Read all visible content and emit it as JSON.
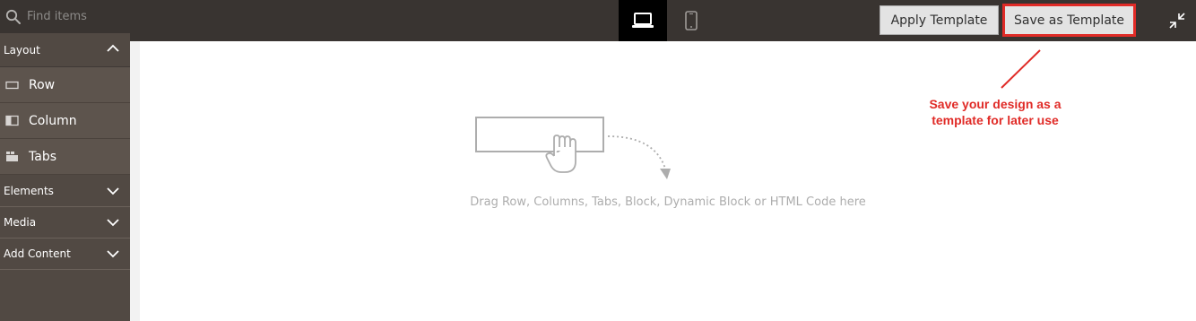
{
  "search": {
    "placeholder": "Find items",
    "value": ""
  },
  "toolbar": {
    "apply_template_label": "Apply Template",
    "save_template_label": "Save as Template",
    "devices": [
      "desktop",
      "mobile"
    ],
    "active_device": "desktop"
  },
  "sidebar": {
    "layout": {
      "label": "Layout",
      "expanded": true,
      "items": [
        {
          "label": "Row",
          "icon": "row-icon"
        },
        {
          "label": "Column",
          "icon": "column-icon"
        },
        {
          "label": "Tabs",
          "icon": "tabs-icon"
        }
      ]
    },
    "sections": [
      {
        "label": "Elements",
        "expanded": false
      },
      {
        "label": "Media",
        "expanded": false
      },
      {
        "label": "Add Content",
        "expanded": false
      }
    ]
  },
  "canvas": {
    "drop_hint": "Drag Row, Columns, Tabs, Block, Dynamic Block or HTML Code here"
  },
  "annotation": {
    "line1": "Save your design as a",
    "line2": "template for later use",
    "color": "#e02b27"
  },
  "colors": {
    "topbar": "#393431",
    "sidebar": "#514943",
    "sidebar_item": "#5d544d",
    "accent": "#e02b27"
  }
}
